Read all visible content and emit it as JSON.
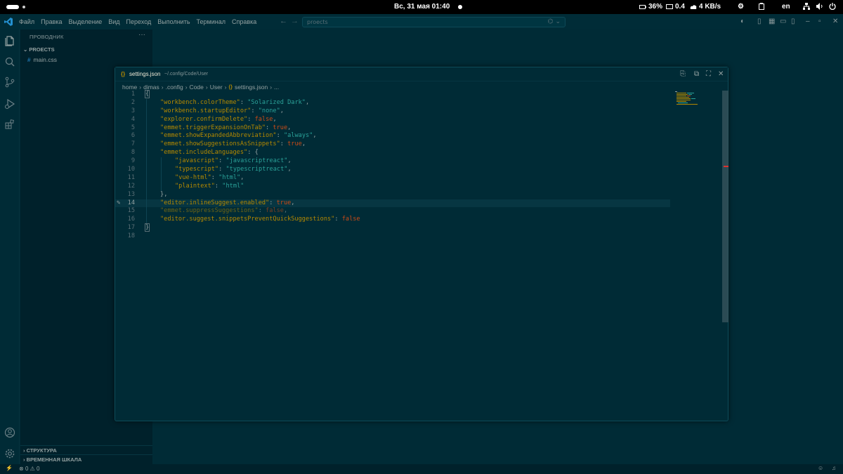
{
  "topbar": {
    "clock": "Вс, 31 мая  01:40",
    "battery": "36%",
    "load": "0.4",
    "net": "4 KB/s",
    "lang": "en"
  },
  "titlebar": {
    "menu": [
      "Файл",
      "Правка",
      "Выделение",
      "Вид",
      "Переход",
      "Выполнить",
      "Терминал",
      "Справка"
    ],
    "search_value": "proects"
  },
  "sidebar": {
    "header": "ПРОВОДНИК",
    "more": "···",
    "folder": "PROECTS",
    "files": [
      "main.css"
    ],
    "bottom_sections": [
      "СТРУКТУРА",
      "ВРЕМЕННАЯ ШКАЛА"
    ]
  },
  "editor": {
    "tab_icon": "{}",
    "filename": "settings.json",
    "path": "~/.config/Code/User",
    "breadcrumbs": [
      "home",
      "dimas",
      ".config",
      "Code",
      "User",
      "settings.json",
      "..."
    ],
    "current_line": 14,
    "lines": [
      "{",
      "\"workbench.colorTheme\": \"Solarized Dark\",",
      "\"workbench.startupEditor\": \"none\",",
      "\"explorer.confirmDelete\": false,",
      "\"emmet.triggerExpansionOnTab\": true,",
      "\"emmet.showExpandedAbbreviation\": \"always\",",
      "\"emmet.showSuggestionsAsSnippets\": true,",
      "\"emmet.includeLanguages\": {",
      "\"javascript\": \"javascriptreact\",",
      "\"typescript\": \"typescriptreact\",",
      "\"vue-html\": \"html\",",
      "\"plaintext\": \"html\"",
      "},",
      "\"editor.inlineSuggest.enabled\": true,",
      "\"emmet.suppressSuggestions\": false,",
      "\"editor.suggest.snippetsPreventQuickSuggestions\": false",
      "}",
      ""
    ]
  },
  "statusbar": {
    "errors": "0",
    "warnings": "0"
  },
  "colors": {
    "background": "#002b36",
    "key": "#b58900",
    "string": "#2aa198",
    "boolean": "#cb4b16"
  }
}
